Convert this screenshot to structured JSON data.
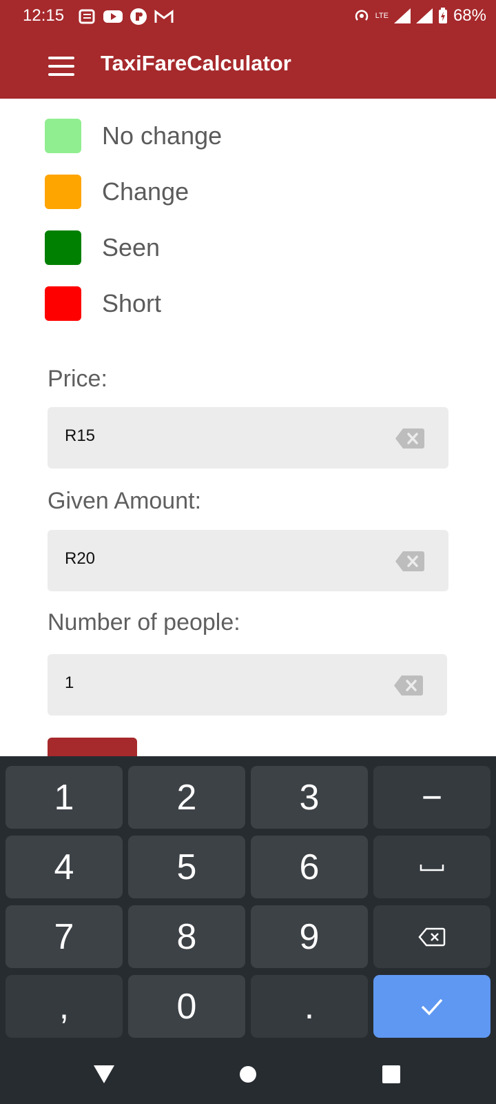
{
  "status_bar": {
    "time": "12:15",
    "battery": "68%",
    "network": "LTE",
    "icons_left": [
      "news-icon",
      "youtube-icon",
      "app-icon",
      "gmail-icon"
    ],
    "icons_right": [
      "hotspot-icon",
      "lte-icon",
      "signal-icon",
      "signal-icon",
      "battery-charging-icon"
    ]
  },
  "app_bar": {
    "title": "TaxiFareCalculator",
    "menu_icon": "hamburger-menu-icon"
  },
  "legend": [
    {
      "label": "No change",
      "color": "#90ee90"
    },
    {
      "label": "Change",
      "color": "#ffa500"
    },
    {
      "label": "Seen",
      "color": "#008000"
    },
    {
      "label": "Short",
      "color": "#ff0000"
    }
  ],
  "fields": {
    "price": {
      "label": "Price:",
      "value": "R15"
    },
    "given": {
      "label": "Given Amount:",
      "value": "R20"
    },
    "people": {
      "label": "Number of people:",
      "value": "1"
    }
  },
  "keyboard": {
    "keys": [
      "1",
      "2",
      "3",
      "−",
      "4",
      "5",
      "6",
      "␣",
      "7",
      "8",
      "9",
      "⌫",
      ",",
      "0",
      ".",
      "✓"
    ]
  },
  "colors": {
    "primary": "#a6292c",
    "field_bg": "#ececec",
    "keyboard_bg": "#272c31",
    "key_bg": "#3d4247",
    "ok_key": "#5f98f2"
  }
}
